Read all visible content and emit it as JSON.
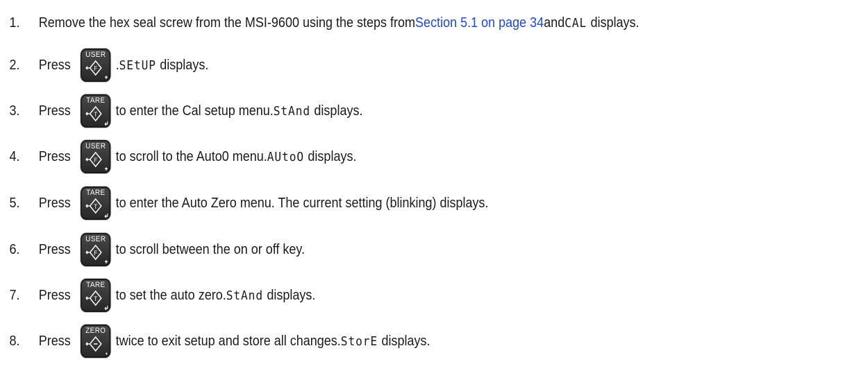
{
  "steps": [
    {
      "number": "1.",
      "text_before": "Remove the hex seal screw from the MSI-9600 using the steps from ",
      "link": "Section 5.1 on page 34",
      "text_mid": " and ",
      "display": "CAL",
      "text_after": "displays."
    },
    {
      "number": "2.",
      "press": "Press",
      "key_label": "USER",
      "key_icon": "f-key-icon",
      "text_before": ". ",
      "display": "SEtUP",
      "text_after": "displays."
    },
    {
      "number": "3.",
      "press": "Press",
      "key_label": "TARE",
      "key_icon": "t-key-icon",
      "text_before": "to enter the Cal setup menu. ",
      "display": "StAnd",
      "text_after": "displays."
    },
    {
      "number": "4.",
      "press": "Press",
      "key_label": "USER",
      "key_icon": "f-key-icon",
      "text_before": "to scroll to the Auto0 menu. ",
      "display": "AUtoO",
      "text_after": "displays."
    },
    {
      "number": "5.",
      "press": "Press",
      "key_label": "TARE",
      "key_icon": "t-key-icon",
      "text_before": "to enter the Auto Zero menu. The current setting (blinking) displays."
    },
    {
      "number": "6.",
      "press": "Press",
      "key_label": "USER",
      "key_icon": "f-key-icon",
      "text_before": "to scroll between the on or off key."
    },
    {
      "number": "7.",
      "press": "Press",
      "key_label": "TARE",
      "key_icon": "t-key-icon",
      "text_before": "to set the auto zero. ",
      "display": "StAnd",
      "text_after": "displays."
    },
    {
      "number": "8.",
      "press": "Press",
      "key_label": "ZERO",
      "key_icon": "zero-key-icon",
      "text_before": "twice to exit setup and store all changes. ",
      "display": "StorE",
      "text_after": "displays."
    }
  ],
  "colors": {
    "link": "#1f49d6",
    "text": "#1a1a1a",
    "key_background": "#333333"
  }
}
